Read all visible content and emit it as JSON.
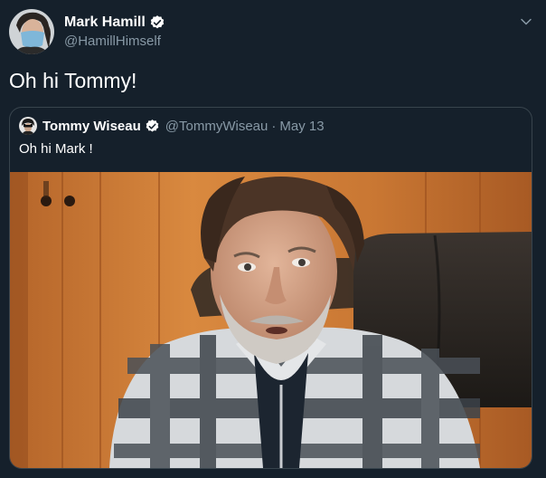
{
  "tweet": {
    "author": {
      "display_name": "Mark Hamill",
      "handle": "@HamillHimself",
      "verified": true
    },
    "text": "Oh hi Tommy!",
    "menu_icon": "chevron-down-icon"
  },
  "quoted_tweet": {
    "author": {
      "display_name": "Tommy Wiseau",
      "handle": "@TommyWiseau",
      "verified": true
    },
    "separator": "·",
    "date": "May 13",
    "text": "Oh hi Mark !",
    "media": "video-still"
  },
  "colors": {
    "background": "#15202b",
    "border": "#38444d",
    "secondary_text": "#8899a6",
    "verified_blue": "#1da1f2"
  }
}
